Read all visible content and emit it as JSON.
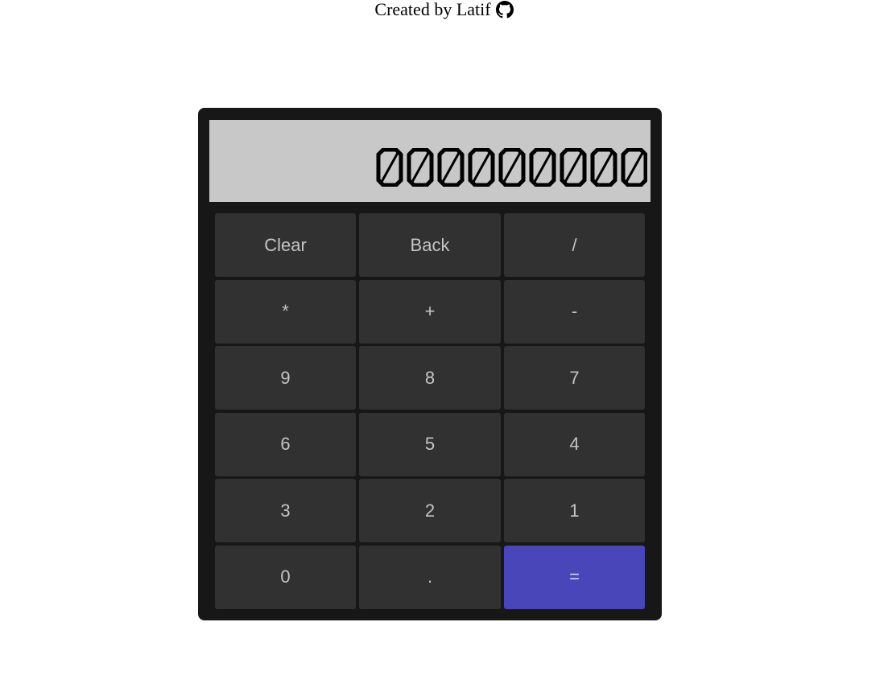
{
  "header": {
    "credit_text": "Created by Latif",
    "credit_icon": "github-icon"
  },
  "display": {
    "value": "000000000"
  },
  "keys": [
    {
      "label": "Clear",
      "name": "clear-button"
    },
    {
      "label": "Back",
      "name": "back-button"
    },
    {
      "label": "/",
      "name": "divide-button"
    },
    {
      "label": "*",
      "name": "multiply-button"
    },
    {
      "label": "+",
      "name": "add-button"
    },
    {
      "label": "-",
      "name": "subtract-button"
    },
    {
      "label": "9",
      "name": "digit-9-button"
    },
    {
      "label": "8",
      "name": "digit-8-button"
    },
    {
      "label": "7",
      "name": "digit-7-button"
    },
    {
      "label": "6",
      "name": "digit-6-button"
    },
    {
      "label": "5",
      "name": "digit-5-button"
    },
    {
      "label": "4",
      "name": "digit-4-button"
    },
    {
      "label": "3",
      "name": "digit-3-button"
    },
    {
      "label": "2",
      "name": "digit-2-button"
    },
    {
      "label": "1",
      "name": "digit-1-button"
    },
    {
      "label": "0",
      "name": "digit-0-button"
    },
    {
      "label": ".",
      "name": "decimal-button"
    },
    {
      "label": "=",
      "name": "equals-button"
    }
  ],
  "colors": {
    "background": "#ffffff",
    "calculator_body": "#171717",
    "display_background": "#c8c8c8",
    "key_background": "#313131",
    "key_text": "#c4c4c4",
    "equals_background": "#4846b8"
  }
}
